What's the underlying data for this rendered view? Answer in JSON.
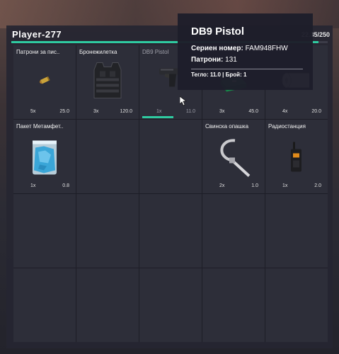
{
  "inventory": {
    "player_name": "Player-277",
    "capacity": "22.35/250",
    "weight_fraction": 0.97,
    "slots": [
      {
        "name": "Патрони за пис..",
        "count": "5x",
        "weight": "25.0",
        "icon": "ammo-icon"
      },
      {
        "name": "Бронежилетка",
        "count": "3x",
        "weight": "120.0",
        "icon": "body-armor-icon"
      },
      {
        "name": "DB9 Pistol",
        "count": "1x",
        "weight": "11.0",
        "icon": "pistol-icon",
        "durability": 1.0
      },
      {
        "name": "",
        "count": "3x",
        "weight": "45.0",
        "icon": "medkit-icon"
      },
      {
        "name": "",
        "count": "4x",
        "weight": "20.0",
        "icon": "bandage-roll-icon"
      },
      {
        "name": "Пакет Метамфет..",
        "count": "1x",
        "weight": "0.8",
        "icon": "meth-bag-icon"
      },
      {
        "name": "",
        "count": "",
        "weight": "",
        "icon": ""
      },
      {
        "name": "",
        "count": "",
        "weight": "",
        "icon": ""
      },
      {
        "name": "Свинска опашка",
        "count": "2x",
        "weight": "1.0",
        "icon": "zip-tie-icon"
      },
      {
        "name": "Радиостанция",
        "count": "1x",
        "weight": "2.0",
        "icon": "radio-icon"
      }
    ]
  },
  "tooltip": {
    "title": "DB9 Pistol",
    "serial_label": "Сериен номер:",
    "serial_value": "FAM948FHW",
    "ammo_label": "Патрони:",
    "ammo_value": "131",
    "footer": "Тегло: 11.0 | Брой: 1"
  },
  "colors": {
    "accent": "#2fcaa0",
    "panel": "#262632",
    "slot": "#2d2e39"
  }
}
